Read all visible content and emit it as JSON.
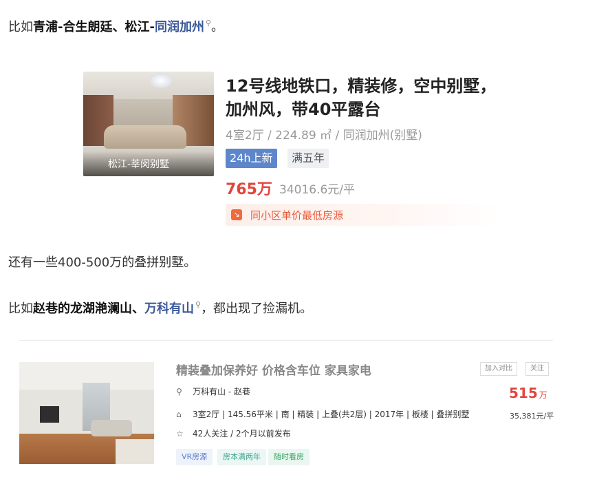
{
  "para1": {
    "prefix": "比如",
    "bold1": "青浦-合生朗廷、松江-",
    "link": "同润加州",
    "suffix": "。"
  },
  "card1": {
    "image_caption": "松江-莘闵别墅",
    "title": "12号线地铁口，精装修，空中别墅，加州风，带40平露台",
    "meta": "4室2厅 / 224.89 ㎡ / 同润加州(别墅)",
    "tag_new": "24h上新",
    "tag_years": "满五年",
    "price": "765万",
    "unit_price": "34016.6元/平",
    "promo_text": "同小区单价最低房源"
  },
  "para2": {
    "text": "还有一些400-500万的叠拼别墅。"
  },
  "para3": {
    "prefix": "比如",
    "bold1": "赵巷的龙湖滟澜山、",
    "link": "万科有山",
    "suffix": "，都出现了捡漏机。"
  },
  "card2": {
    "title": "精装叠加保养好 价格含车位 家具家电",
    "btn_compare": "加入对比",
    "btn_follow": "关注",
    "location": "万科有山 - 赵巷",
    "details": "3室2厅 | 145.56平米 | 南 | 精装 | 上叠(共2层) | 2017年 | 板楼 | 叠拼别墅",
    "followers": "42人关注 / 2个月以前发布",
    "price_num": "515",
    "price_unit": "万",
    "unit_price": "35,381元/平",
    "tags": [
      "VR房源",
      "房本满两年",
      "随时看房"
    ]
  },
  "colors": {
    "price_red": "#e2453c",
    "tag_blue": "#5d86cb",
    "link_blue": "#3b5998"
  },
  "icons": [
    "search-icon",
    "location-pin-icon",
    "house-icon",
    "star-icon",
    "promo-arrow-icon"
  ]
}
